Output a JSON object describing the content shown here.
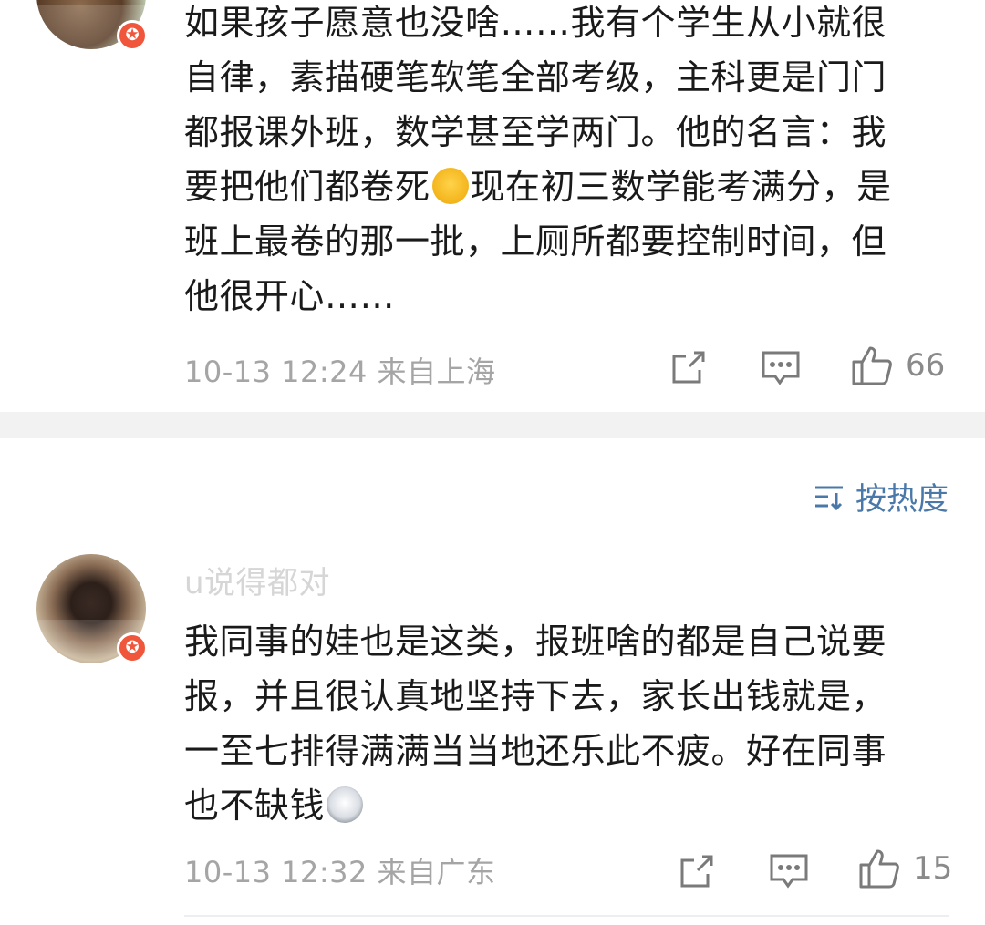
{
  "comments": [
    {
      "text_before_emoji": "如果孩子愿意也没啥……我有个学生从小就很\n自律，素描硬笔软笔全部考级，主科更是门门\n都报课外班，数学甚至学两门。他的名言：我\n要把他们都卷死",
      "emoji": "laughing-tears-emoji",
      "text_after_emoji": "现在初三数学能考满分，是\n班上最卷的那一批，上厕所都要控制时间，但\n他很开心……",
      "time": "10-13 12:24",
      "location": "来自上海",
      "likes": "66"
    },
    {
      "username": "u说得都对",
      "text_before_emoji": "我同事的娃也是这类，报班啥的都是自己说要\n报，并且很认真地坚持下去，家长出钱就是，\n一至七排得满满当当地还乐此不疲。好在同事\n也不缺钱",
      "emoji": "husky-emoji",
      "time": "10-13 12:32",
      "location": "来自广东",
      "likes": "15"
    }
  ],
  "sort": {
    "label": "按热度"
  },
  "colors": {
    "accent": "#4a78a8",
    "badge": "#f0563b",
    "meta": "#a5a5a5"
  }
}
